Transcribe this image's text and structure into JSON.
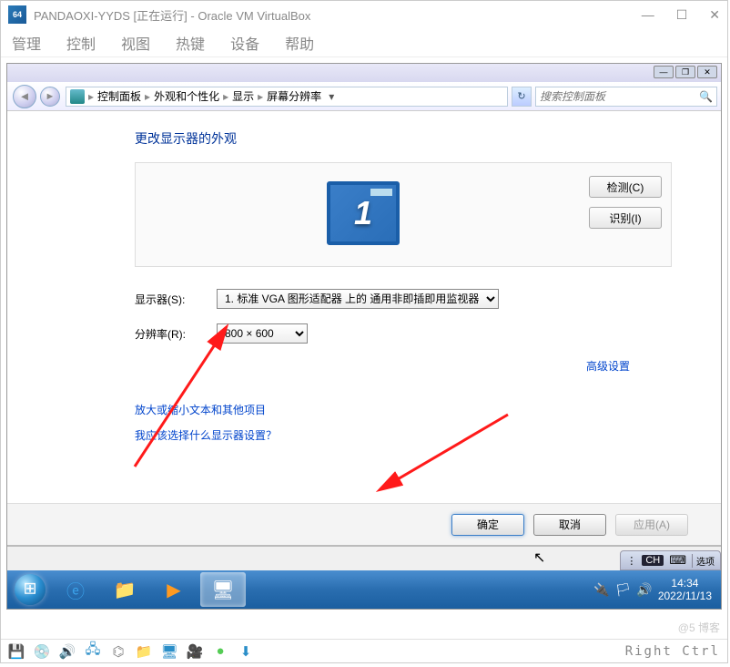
{
  "virtualbox": {
    "title": "PANDAOXI-YYDS [正在运行] - Oracle VM VirtualBox",
    "menu": [
      "管理",
      "控制",
      "视图",
      "热键",
      "设备",
      "帮助"
    ],
    "host_key": "Right Ctrl"
  },
  "control_panel": {
    "breadcrumb": [
      "控制面板",
      "外观和个性化",
      "显示",
      "屏幕分辨率"
    ],
    "search_placeholder": "搜索控制面板",
    "heading": "更改显示器的外观",
    "monitor_number": "1",
    "buttons": {
      "detect": "检测(C)",
      "identify": "识别(I)"
    },
    "display_label": "显示器(S):",
    "display_value": "1. 标准 VGA 图形适配器 上的 通用非即插即用监视器",
    "resolution_label": "分辨率(R):",
    "resolution_value": "800 × 600",
    "advanced_link": "高级设置",
    "link1": "放大或缩小文本和其他项目",
    "link2": "我应该选择什么显示器设置？",
    "footer": {
      "ok": "确定",
      "cancel": "取消",
      "apply": "应用(A)"
    }
  },
  "ime": {
    "lang": "CH",
    "option": "选项"
  },
  "taskbar": {
    "time": "14:34",
    "date": "2022/11/13"
  },
  "watermark": "@5  博客"
}
